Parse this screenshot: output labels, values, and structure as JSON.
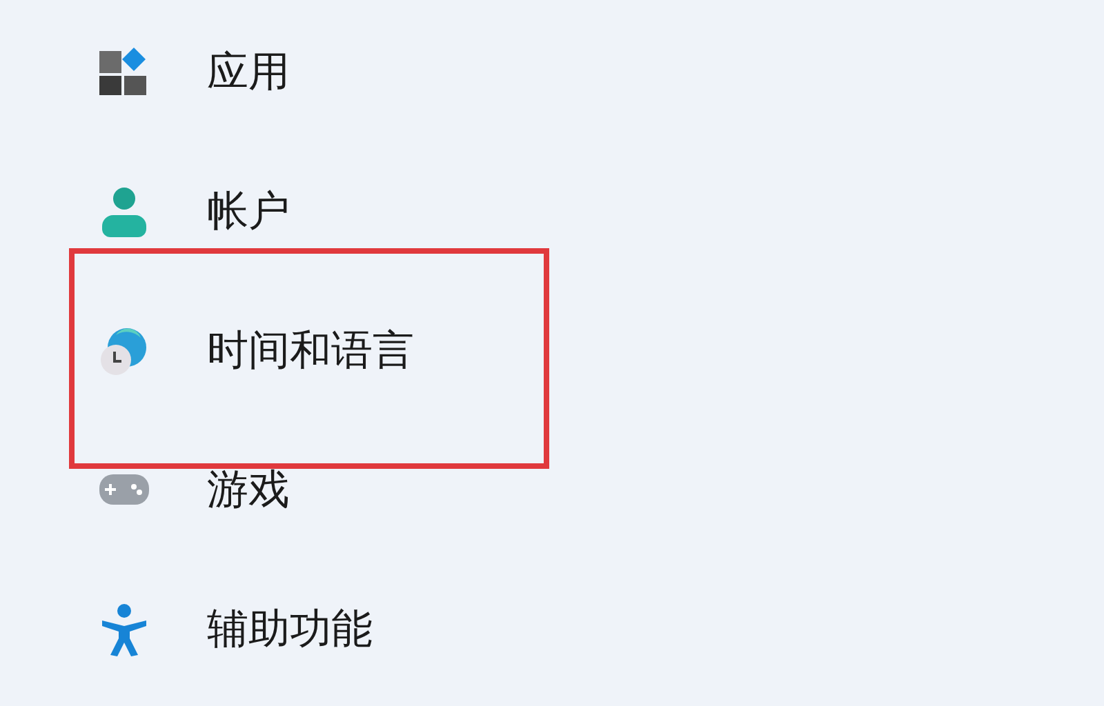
{
  "sidebar": {
    "items": [
      {
        "kind": "apps",
        "label": "应用",
        "highlighted": false
      },
      {
        "kind": "accounts",
        "label": "帐户",
        "highlighted": false
      },
      {
        "kind": "time",
        "label": "时间和语言",
        "highlighted": true
      },
      {
        "kind": "gaming",
        "label": "游戏",
        "highlighted": false
      },
      {
        "kind": "accessibility",
        "label": "辅助功能",
        "highlighted": false
      }
    ]
  }
}
